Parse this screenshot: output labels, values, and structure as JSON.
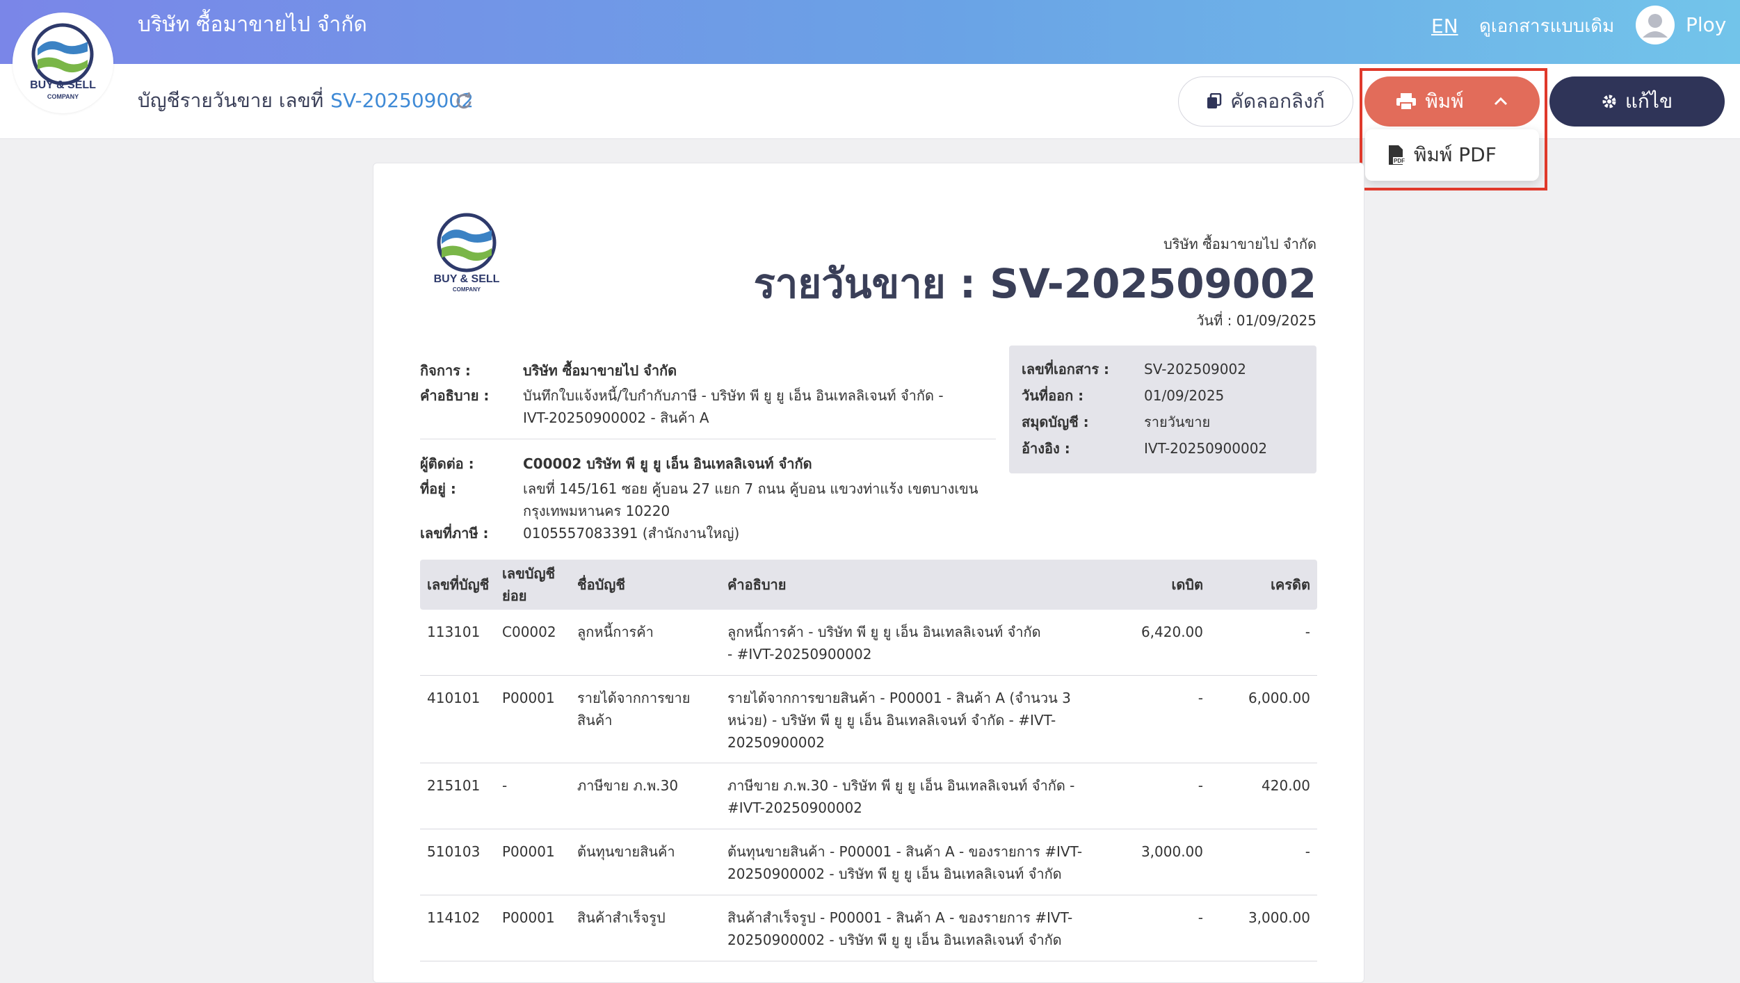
{
  "header": {
    "logo_text_main": "BUY & SELL",
    "logo_text_sub": "COMPANY",
    "company_name": "บริษัท ซื้อมาขายไป จำกัด",
    "lang": "EN",
    "legacy_link": "ดูเอกสารแบบเดิม",
    "user_name": "Ploy"
  },
  "subheader": {
    "title": "บัญชีรายวันขาย เลขที่",
    "doc_no": "SV-202509002",
    "copy_link_label": "คัดลอกลิงก์",
    "print_label": "พิมพ์",
    "edit_label": "แก้ไข",
    "print_menu": {
      "pdf_label": "พิมพ์ PDF"
    }
  },
  "document": {
    "logo_text_main": "BUY & SELL",
    "logo_text_sub": "COMPANY",
    "company": "บริษัท ซื้อมาขายไป จำกัด",
    "title": "รายวันขาย : SV-202509002",
    "date": "วันที่ : 01/09/2025",
    "info": {
      "business_label": "กิจการ :",
      "business_value": "บริษัท ซื้อมาขายไป จำกัด",
      "desc_label": "คำอธิบาย :",
      "desc_value": "บันทึกใบแจ้งหนี้/ใบกำกับภาษี - บริษัท พี ยู ยู เอ็น อินเทลลิเจนท์ จำกัด - IVT-20250900002 - สินค้า A",
      "contact_label": "ผู้ติดต่อ :",
      "contact_value": "C00002 บริษัท พี ยู ยู เอ็น อินเทลลิเจนท์ จำกัด",
      "address_label": "ที่อยู่ :",
      "address_line1": "เลขที่ 145/161 ซอย คู้บอน 27 แยก 7 ถนน คู้บอน แขวงท่าแร้ง เขตบางเขน",
      "address_line2": "กรุงเทพมหานคร 10220",
      "tax_label": "เลขที่ภาษี :",
      "tax_value": "0105557083391 (สำนักงานใหญ่)"
    },
    "meta": {
      "doc_no_label": "เลขที่เอกสาร :",
      "doc_no_value": "SV-202509002",
      "issue_label": "วันที่ออก :",
      "issue_value": "01/09/2025",
      "book_label": "สมุดบัญชี :",
      "book_value": "รายวันขาย",
      "ref_label": "อ้างอิง :",
      "ref_value": "IVT-20250900002"
    },
    "table": {
      "headers": {
        "acct": "เลขที่บัญชี",
        "sub_line1": "เลขบัญชี",
        "sub_line2": "ย่อย",
        "name": "ชื่อบัญชี",
        "desc": "คำอธิบาย",
        "debit": "เดบิต",
        "credit": "เครดิต"
      },
      "rows": [
        {
          "acct": "113101",
          "sub": "C00002",
          "name": [
            "ลูกหนี้การค้า"
          ],
          "desc": [
            "ลูกหนี้การค้า - บริษัท พี ยู ยู เอ็น อินเทลลิเจนท์ จำกัด",
            "- #IVT-20250900002"
          ],
          "debit": "6,420.00",
          "credit": "-"
        },
        {
          "acct": "410101",
          "sub": "P00001",
          "name": [
            "รายได้จากการขาย",
            "สินค้า"
          ],
          "desc": [
            "รายได้จากการขายสินค้า - P00001 - สินค้า A (จำนวน 3",
            "หน่วย) - บริษัท พี ยู ยู เอ็น อินเทลลิเจนท์ จำกัด - #IVT-",
            "20250900002"
          ],
          "debit": "-",
          "credit": "6,000.00"
        },
        {
          "acct": "215101",
          "sub": "-",
          "name": [
            "ภาษีขาย ภ.พ.30"
          ],
          "desc": [
            "ภาษีขาย ภ.พ.30 - บริษัท พี ยู ยู เอ็น อินเทลลิเจนท์ จำกัด -",
            "#IVT-20250900002"
          ],
          "debit": "-",
          "credit": "420.00"
        },
        {
          "acct": "510103",
          "sub": "P00001",
          "name": [
            "ต้นทุนขายสินค้า"
          ],
          "desc": [
            "ต้นทุนขายสินค้า - P00001 - สินค้า A - ของรายการ #IVT-",
            "20250900002 - บริษัท พี ยู ยู เอ็น อินเทลลิเจนท์ จำกัด"
          ],
          "debit": "3,000.00",
          "credit": "-"
        },
        {
          "acct": "114102",
          "sub": "P00001",
          "name": [
            "สินค้าสำเร็จรูป"
          ],
          "desc": [
            "สินค้าสำเร็จรูป - P00001 - สินค้า A - ของรายการ #IVT-",
            "20250900002 - บริษัท พี ยู ยู เอ็น อินเทลลิเจนท์ จำกัด"
          ],
          "debit": "-",
          "credit": "3,000.00"
        }
      ]
    }
  },
  "colors": {
    "print_button": "#e26c5a",
    "edit_button": "#2f3458",
    "link_blue": "#3f8ad6",
    "highlight": "#e0392b"
  },
  "icons": [
    "copy-icon",
    "printer-icon",
    "chevron-up-icon",
    "gear-icon",
    "pdf-icon",
    "refresh-icon",
    "user-icon",
    "company-logo"
  ]
}
